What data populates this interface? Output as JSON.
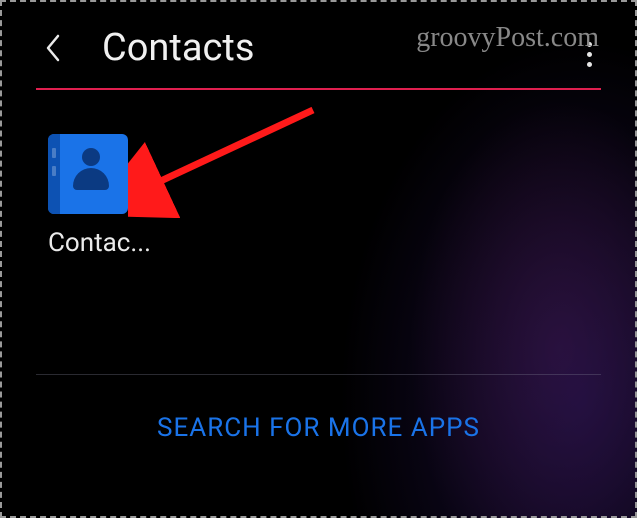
{
  "header": {
    "title": "Contacts"
  },
  "apps": [
    {
      "label": "Contac...",
      "icon_name": "contacts-icon",
      "icon_bg": "#1a73e8"
    }
  ],
  "footer": {
    "search_more_label": "SEARCH FOR MORE APPS"
  },
  "watermark": "groovyPost.com",
  "colors": {
    "accent_underline": "#e01f4f",
    "link": "#1a73e8"
  }
}
